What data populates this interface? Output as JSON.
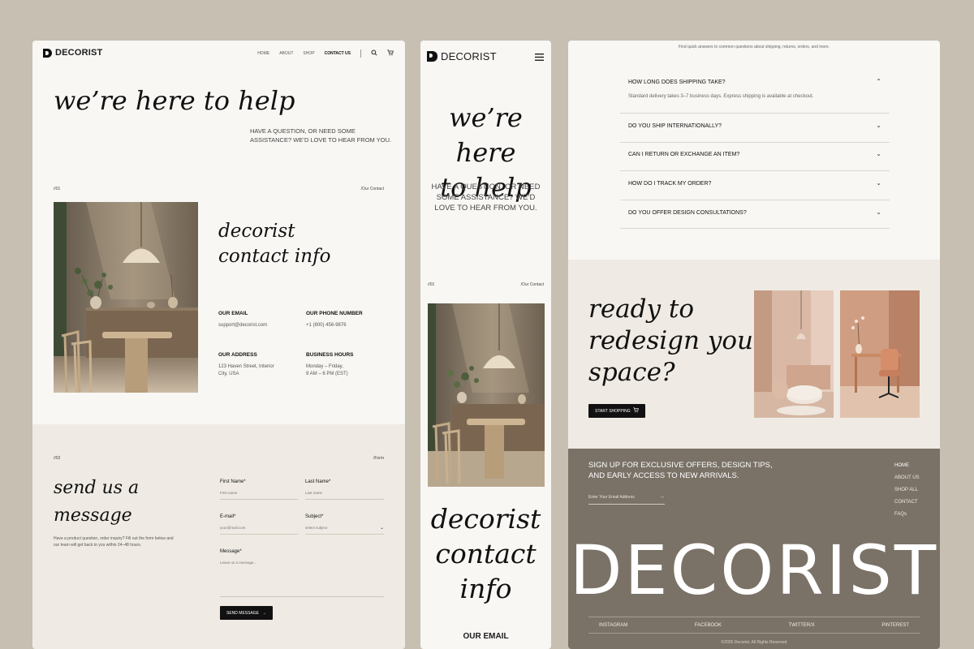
{
  "brand": "DECORIST",
  "desktop": {
    "nav": [
      "HOME",
      "ABOUT",
      "SHOP",
      "CONTACT US"
    ],
    "nav_active": "CONTACT US",
    "hero_title": "we’re here to help",
    "hero_subtitle": "HAVE A QUESTION, OR NEED SOME ASSISTANCE? WE’D LOVE TO HEAR FROM YOU.",
    "section1_num": "//01",
    "section1_tag": "/Our Contact",
    "info_title_line1": "decorist",
    "info_title_line2": "contact info",
    "email_label": "OUR EMAIL",
    "email_value": "support@decorist.com",
    "phone_label": "OUR PHONE NUMBER",
    "phone_value": "+1 (800) 456-9876",
    "address_label": "OUR ADDRESS",
    "address_value_line1": "123 Haven Street, Interior",
    "address_value_line2": "City, USA",
    "hours_label": "BUSINESS HOURS",
    "hours_value_line1": "Monday – Friday,",
    "hours_value_line2": "9 AM – 6 PM (EST)",
    "section2_num": "//02",
    "section2_tag": "/Form",
    "form_title_line1": "send us a",
    "form_title_line2": "message",
    "form_desc": "Have a product question, order inquiry? Fill out the form below and our team will get back to you within 24–48 hours.",
    "first_name_label": "First Name*",
    "first_name_placeholder": "First name",
    "last_name_label": "Last Name*",
    "last_name_placeholder": "Last name",
    "email_field_label": "E-mail*",
    "email_field_placeholder": "your@mail.com",
    "subject_label": "Subject*",
    "subject_placeholder": "select subject",
    "message_label": "Message*",
    "message_placeholder": "Leave us a message...",
    "send_button": "SEND MESSAGE"
  },
  "mobile": {
    "hero_title_line1": "we’re here",
    "hero_title_line2": "to help",
    "hero_subtitle": "HAVE A QUESTION, OR NEED SOME ASSISTANCE? WE’D LOVE TO HEAR FROM YOU.",
    "section1_num": "//01",
    "section1_tag": "/Our Contact",
    "info_title_line1": "decorist",
    "info_title_line2": "contact",
    "info_title_line3": "info",
    "email_label": "OUR EMAIL"
  },
  "faq": {
    "intro": "Find quick answers to common questions about shipping, returns, orders, and more.",
    "items": [
      {
        "q": "HOW LONG DOES SHIPPING TAKE?",
        "a": "Standard delivery takes 3–7 business days. Express shipping is available at checkout.",
        "open": true
      },
      {
        "q": "DO YOU SHIP INTERNATIONALLY?",
        "a": "",
        "open": false
      },
      {
        "q": "CAN I RETURN OR EXCHANGE AN ITEM?",
        "a": "",
        "open": false
      },
      {
        "q": "HOW DO I TRACK MY ORDER?",
        "a": "",
        "open": false
      },
      {
        "q": "DO YOU OFFER DESIGN CONSULTATIONS?",
        "a": "",
        "open": false
      }
    ]
  },
  "cta": {
    "title_line1": "ready to",
    "title_line2": "redesign your",
    "title_line3": "space?",
    "button": "START SHOPPING"
  },
  "footer": {
    "newsletter": "SIGN UP FOR EXCLUSIVE OFFERS, DESIGN TIPS, AND EARLY ACCESS TO NEW ARRIVALS.",
    "email_placeholder": "Enter Your Email Address",
    "links": [
      "HOME",
      "ABOUT US",
      "SHOP ALL",
      "CONTACT",
      "FAQs"
    ],
    "big_brand": "DECORIST",
    "social": [
      "INSTAGRAM",
      "FACEBOOK",
      "TWITTER/X",
      "PINTEREST"
    ],
    "copyright": "©2025 Decorist. All Rights Reserved"
  },
  "colors": {
    "background": "#c7bfb2",
    "panel": "#f8f7f4",
    "beige_section": "#efebe4",
    "footer": "#7a7267",
    "button": "#111111"
  }
}
